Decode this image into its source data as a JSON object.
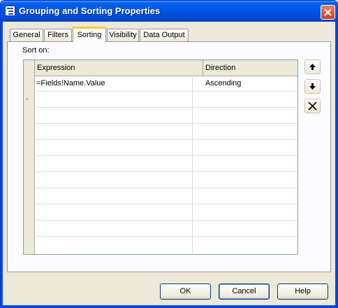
{
  "window": {
    "title": "Grouping and Sorting Properties"
  },
  "tabs": [
    {
      "label": "General"
    },
    {
      "label": "Filters"
    },
    {
      "label": "Sorting"
    },
    {
      "label": "Visibility"
    },
    {
      "label": "Data Output"
    }
  ],
  "active_tab": "Sorting",
  "sorting": {
    "label": "Sort on:",
    "columns": [
      {
        "label": "Expression"
      },
      {
        "label": "Direction"
      }
    ],
    "rows": [
      {
        "expression": "=Fields!Name.Value",
        "direction": "Ascending"
      }
    ],
    "new_row_marker": "*"
  },
  "side_buttons": {
    "move_up": "arrow-up-icon",
    "move_down": "arrow-down-icon",
    "delete": "delete-x-icon"
  },
  "buttons": {
    "ok": "OK",
    "cancel": "Cancel",
    "help": "Help"
  },
  "colors": {
    "titlebar": "#0055e5",
    "dialog_bg": "#ece9d8",
    "active_tab_accent": "#ffc83c",
    "close_button": "#c6421e"
  }
}
